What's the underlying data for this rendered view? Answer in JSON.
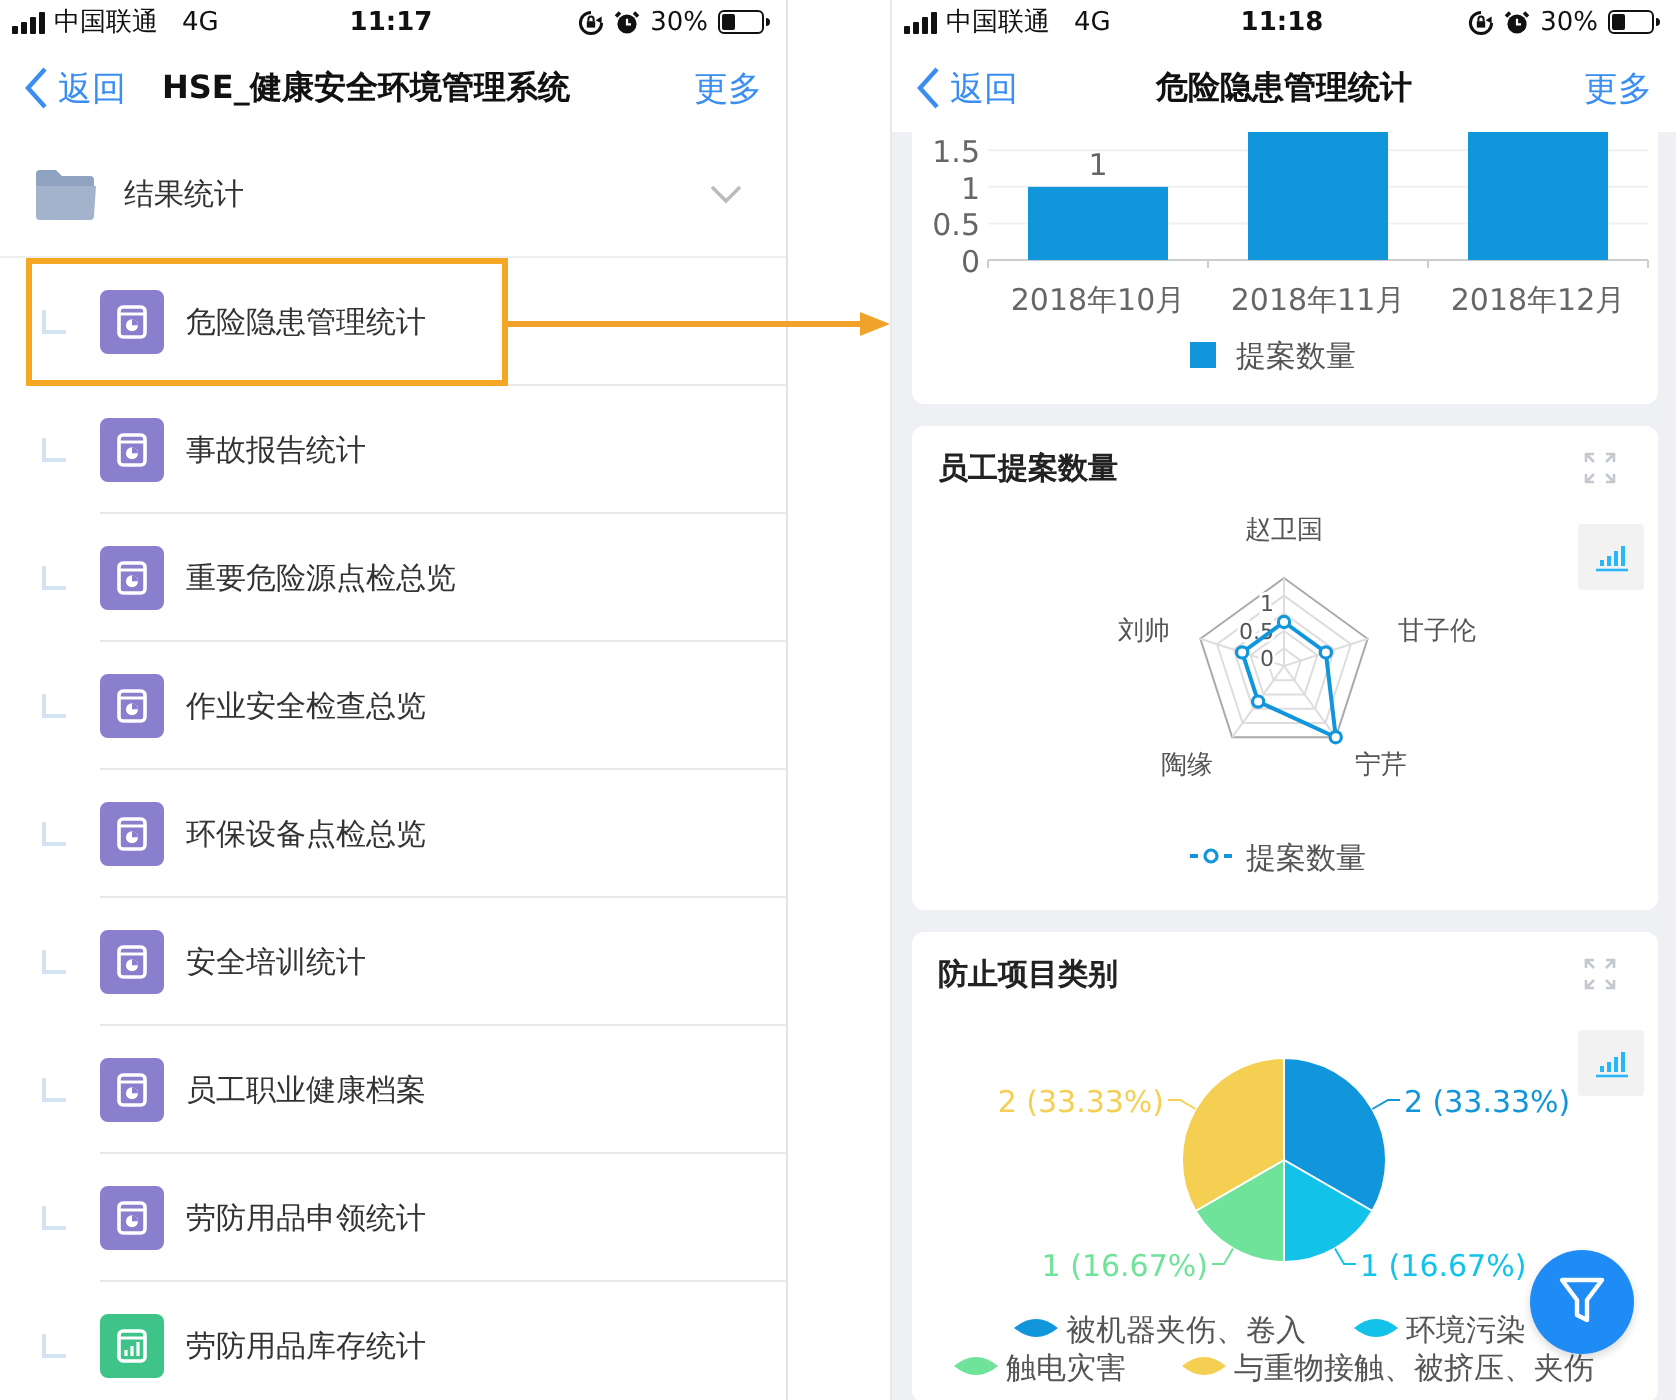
{
  "left_screen": {
    "status_bar": {
      "carrier": "中国联通",
      "network": "4G",
      "time": "11:17",
      "battery": "30%"
    },
    "nav_bar": {
      "back": "返回",
      "title": "HSE_健康安全环境管理系统",
      "more": "更多"
    },
    "folder": {
      "label": "结果统计",
      "expanded": true
    },
    "items": [
      {
        "label": "危险隐患管理统计",
        "kind": "pie",
        "selected": true
      },
      {
        "label": "事故报告统计",
        "kind": "pie",
        "selected": false
      },
      {
        "label": "重要危险源点检总览",
        "kind": "pie",
        "selected": false
      },
      {
        "label": "作业安全检查总览",
        "kind": "pie",
        "selected": false
      },
      {
        "label": "环保设备点检总览",
        "kind": "pie",
        "selected": false
      },
      {
        "label": "安全培训统计",
        "kind": "pie",
        "selected": false
      },
      {
        "label": "员工职业健康档案",
        "kind": "pie",
        "selected": false
      },
      {
        "label": "劳防用品申领统计",
        "kind": "pie",
        "selected": false
      },
      {
        "label": "劳防用品库存统计",
        "kind": "bars",
        "selected": false
      }
    ]
  },
  "right_screen": {
    "status_bar": {
      "carrier": "中国联通",
      "network": "4G",
      "time": "11:18",
      "battery": "30%"
    },
    "nav_bar": {
      "back": "返回",
      "title": "危险隐患管理统计",
      "more": "更多"
    },
    "cards": [
      {
        "chart_data": {
          "type": "bar",
          "categories": [
            "2018年10月",
            "2018年11月",
            "2018年12月"
          ],
          "series": [
            {
              "name": "提案数量",
              "color": "#1296db",
              "values": [
                1,
                1.75,
                1.75
              ]
            }
          ],
          "ylim": [
            0,
            1.75
          ],
          "yticks": [
            0,
            0.5,
            1,
            1.5
          ],
          "grid": true,
          "legend": "bottom",
          "value_labels": [
            "1"
          ]
        }
      },
      {
        "title": "员工提案数量",
        "chart_data": {
          "type": "radar",
          "categories": [
            "赵卫国",
            "甘子伦",
            "宁芹",
            "陶缘",
            "刘帅"
          ],
          "series": [
            {
              "name": "提案数量",
              "color": "#1296db",
              "values": [
                1,
                1,
                2,
                1,
                1
              ]
            }
          ],
          "ylim": [
            0,
            2
          ],
          "yticks": [
            1,
            0.5,
            0
          ],
          "legend": "bottom"
        }
      },
      {
        "title": "防止项目类别",
        "chart_data": {
          "type": "pie",
          "categories": [
            "被机器夹伤、卷入",
            "环境污染",
            "触电灾害",
            "与重物接触、被挤压、夹伤"
          ],
          "values": [
            2,
            1,
            1,
            2
          ],
          "colors": [
            "#1296db",
            "#13c2e9",
            "#6fe39a",
            "#f5cf52"
          ],
          "legend": "bottom",
          "value_labels": [
            "2 (33.33%)",
            "1 (16.67%)",
            "1 (16.67%)",
            "2 (33.33%)"
          ]
        }
      }
    ]
  }
}
